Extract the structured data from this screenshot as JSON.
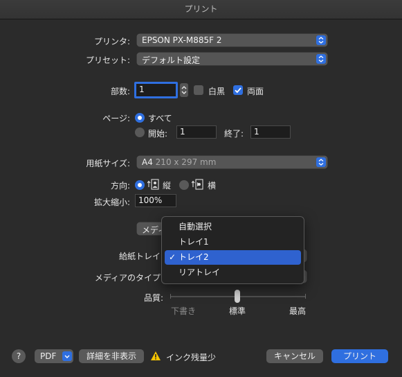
{
  "window": {
    "title": "プリント"
  },
  "printer": {
    "label": "プリンタ:",
    "value": "EPSON PX-M885F 2"
  },
  "preset": {
    "label": "プリセット:",
    "value": "デフォルト設定"
  },
  "copies": {
    "label": "部数:",
    "value": "1",
    "bw_label": "白黒",
    "bw_checked": false,
    "duplex_label": "両面",
    "duplex_checked": true
  },
  "pages": {
    "label": "ページ:",
    "all_label": "すべて",
    "start_label": "開始:",
    "start_value": "1",
    "end_label": "終了:",
    "end_value": "1",
    "selected": "all"
  },
  "paper": {
    "label": "用紙サイズ:",
    "size": "A4",
    "dimensions": "210 x 297 mm"
  },
  "orientation": {
    "label": "方向:",
    "portrait_label": "縦",
    "landscape_label": "横",
    "selected": "portrait"
  },
  "scale": {
    "label": "拡大縮小:",
    "value": "100%"
  },
  "section_popup": {
    "visible_text": "メディ"
  },
  "paper_source": {
    "label": "給紙トレイ"
  },
  "media_type": {
    "label": "メディアのタイプ"
  },
  "source_menu": {
    "items": [
      "自動選択",
      "トレイ1",
      "トレイ2",
      "リアトレイ"
    ],
    "selected": "トレイ2",
    "checkmark": "✓"
  },
  "quality": {
    "label": "品質:",
    "low": "下書き",
    "mid": "標準",
    "high": "最高",
    "level": "標準"
  },
  "footer": {
    "help": "?",
    "pdf": "PDF",
    "hide_details": "詳細を非表示",
    "warning": "インク残量少",
    "cancel": "キャンセル",
    "print": "プリント"
  },
  "colors": {
    "accent": "#2f6fe0",
    "warning": "#f5c400"
  }
}
